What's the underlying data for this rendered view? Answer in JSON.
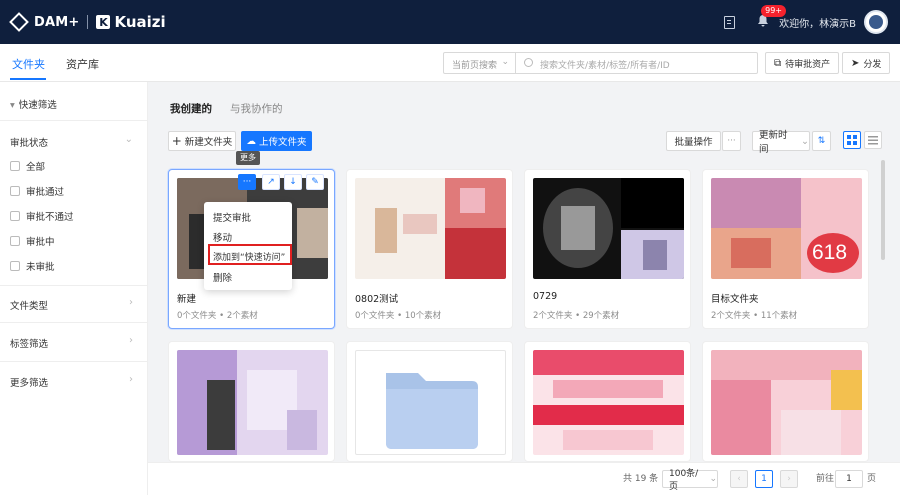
{
  "topbar": {
    "product": "DAM+",
    "brand_mark": "K",
    "brand": "Kuaizi",
    "notification_badge": "99+",
    "welcome": "欢迎你，林演示B"
  },
  "tabs": {
    "folder": "文件夹",
    "library": "资产库"
  },
  "search": {
    "scope": "当前页搜索",
    "placeholder": "搜索文件夹/素材/标签/所有者/ID",
    "pending_button": "待审批资产",
    "share_button": "分发"
  },
  "sidebar": {
    "quick_filter": "快速筛选",
    "approval_status": "审批状态",
    "approval_options": [
      "全部",
      "审批通过",
      "审批不通过",
      "审批中",
      "未审批"
    ],
    "file_type": "文件类型",
    "tag_filter": "标签筛选",
    "more_filter": "更多筛选"
  },
  "main": {
    "tab_created": "我创建的",
    "tab_collab": "与我协作的",
    "new_folder": "新建文件夹",
    "upload_folder": "上传文件夹",
    "batch": "批量操作",
    "more_dots": "···",
    "sort": "更新时间",
    "tooltip_more": "更多"
  },
  "menu": {
    "items": [
      "提交审批",
      "移动",
      "添加到“快速访问”",
      "删除"
    ]
  },
  "folders": [
    {
      "name": "新建",
      "meta": "0个文件夹 • 2个素材"
    },
    {
      "name": "0802测试",
      "meta": "0个文件夹 • 10个素材"
    },
    {
      "name": "0729",
      "meta": "2个文件夹 • 29个素材"
    },
    {
      "name": "目标文件夹",
      "meta": "2个文件夹 • 11个素材"
    }
  ],
  "thumb_text": {
    "sale": "618"
  },
  "pagination": {
    "total": "共 19 条",
    "page_size": "100条/页",
    "current": "1",
    "goto_label": "前往",
    "goto_value": "1",
    "page_suffix": "页"
  },
  "colors": {
    "topbar": "#0f1f3d",
    "accent": "#1677ff",
    "highlight": "#e02020"
  }
}
